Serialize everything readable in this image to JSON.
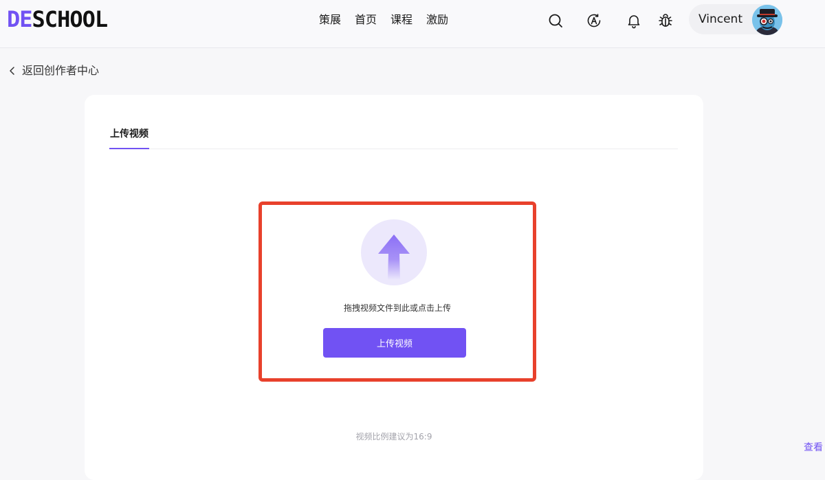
{
  "header": {
    "logo": {
      "accent": "DE",
      "rest": "SCHOOL"
    },
    "nav": [
      "策展",
      "首页",
      "课程",
      "激励"
    ],
    "icons": [
      "search-icon",
      "translate-icon",
      "bell-icon",
      "bug-icon"
    ],
    "user": {
      "name": "Vincent"
    }
  },
  "back": {
    "label": "返回创作者中心"
  },
  "card": {
    "tab": "上传视频",
    "upload": {
      "hint": "拖拽视频文件到此或点击上传",
      "button": "上传视频"
    },
    "ratio_hint": "视频比例建议为16:9"
  },
  "side_link": {
    "label": "查看"
  },
  "colors": {
    "brand": "#7152f3",
    "highlight_border": "#e8412c",
    "page_bg": "#f7f7f9"
  }
}
